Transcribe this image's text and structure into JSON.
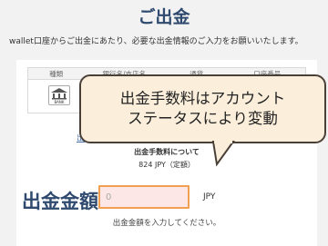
{
  "page": {
    "title": "ご出金",
    "intro": "wallet口座からご出金にあたり、必要な出金情報のご入力をお願いいたします。"
  },
  "table": {
    "headers": [
      "種類",
      "銀行名/支店名",
      "通貨",
      "口座番号"
    ],
    "bank_icon": "bank-icon",
    "bank_icon_text": "BANK"
  },
  "detail_link": "出",
  "fee": {
    "heading": "出金手数料について",
    "value": "824 JPY（定額）"
  },
  "amount": {
    "label": "出金金額",
    "placeholder": "0",
    "unit": "JPY",
    "hint": "出金金額を入力してください。"
  },
  "callout": {
    "line1": "出金手数料はアカウント",
    "line2": "ステータスにより変動"
  },
  "colors": {
    "title": "#2f4a6e",
    "input_bg": "#fde6e6",
    "input_border": "#f0a050",
    "callout_bg": "#fbefdc",
    "callout_border": "#4a4038"
  }
}
